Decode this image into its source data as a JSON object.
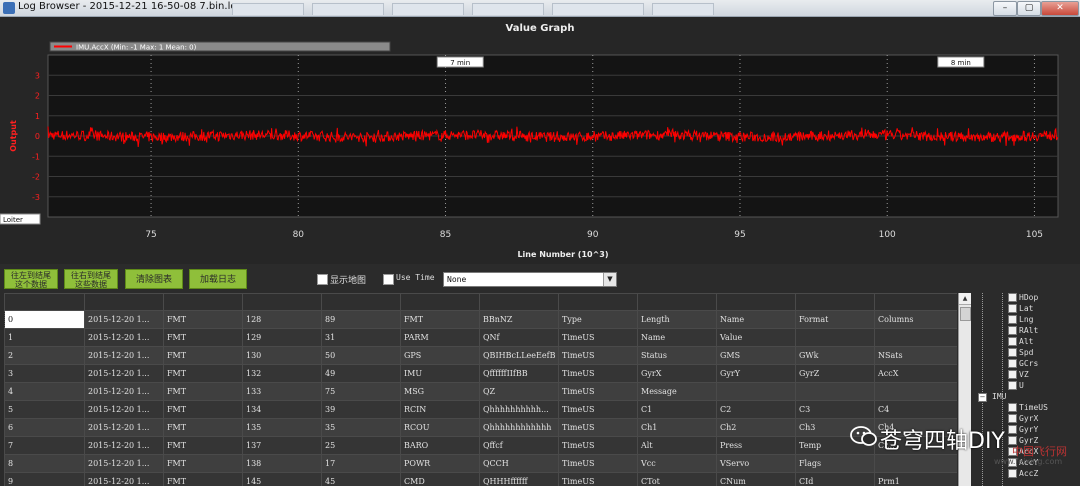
{
  "window": {
    "title": "Log Browser - 2015-12-21 16-50-08 7.bin.log",
    "buttons": [
      "–",
      "▢",
      "✕"
    ]
  },
  "graph": {
    "title": "Value Graph",
    "legend": "IMU.AccX (Min: -1 Max: 1 Mean: 0)",
    "mode_label": "Loiter",
    "time_markers": [
      {
        "label": "7 min",
        "x": 85.5
      },
      {
        "label": "8 min",
        "x": 102.5
      }
    ]
  },
  "chart_data": {
    "type": "line",
    "title": "Value Graph",
    "xlabel": "Line Number (10^3)",
    "ylabel": "Output",
    "xlim": [
      71.5,
      105.8
    ],
    "ylim": [
      -4,
      4
    ],
    "xticks": [
      75,
      80,
      85,
      90,
      95,
      100,
      105
    ],
    "yticks": [
      -4,
      -3,
      -2,
      -1,
      0,
      1,
      2,
      3
    ],
    "grid": true,
    "series": [
      {
        "name": "IMU.AccX",
        "color": "#ff0000",
        "min": -1,
        "max": 1,
        "mean": 0,
        "approx_band": [
          -0.35,
          0.45
        ]
      }
    ]
  },
  "toolbar": {
    "btn_left": [
      "往左到结尾",
      "这个数据"
    ],
    "btn_right": [
      "往右到结尾",
      "这些数据"
    ],
    "btn_clear": "清除图表",
    "btn_load": "加载日志",
    "show_map": "显示地图",
    "use_time": "Use Time",
    "select_value": "None"
  },
  "table": {
    "rows": [
      [
        "0",
        "2015-12-20 1...",
        "FMT",
        "128",
        "89",
        "FMT",
        "BBnNZ",
        "Type",
        "Length",
        "Name",
        "Format",
        "Columns"
      ],
      [
        "1",
        "2015-12-20 1...",
        "FMT",
        "129",
        "31",
        "PARM",
        "QNf",
        "TimeUS",
        "Name",
        "Value",
        "",
        ""
      ],
      [
        "2",
        "2015-12-20 1...",
        "FMT",
        "130",
        "50",
        "GPS",
        "QBIHBcLLeeEefB",
        "TimeUS",
        "Status",
        "GMS",
        "GWk",
        "NSats"
      ],
      [
        "3",
        "2015-12-20 1...",
        "FMT",
        "132",
        "49",
        "IMU",
        "QffffffIIfBB",
        "TimeUS",
        "GyrX",
        "GyrY",
        "GyrZ",
        "AccX"
      ],
      [
        "4",
        "2015-12-20 1...",
        "FMT",
        "133",
        "75",
        "MSG",
        "QZ",
        "TimeUS",
        "Message",
        "",
        "",
        ""
      ],
      [
        "5",
        "2015-12-20 1...",
        "FMT",
        "134",
        "39",
        "RCIN",
        "Qhhhhhhhhhh...",
        "TimeUS",
        "C1",
        "C2",
        "C3",
        "C4"
      ],
      [
        "6",
        "2015-12-20 1...",
        "FMT",
        "135",
        "35",
        "RCOU",
        "Qhhhhhhhhhhhh",
        "TimeUS",
        "Ch1",
        "Ch2",
        "Ch3",
        "Ch4"
      ],
      [
        "7",
        "2015-12-20 1...",
        "FMT",
        "137",
        "25",
        "BARO",
        "Qffcf",
        "TimeUS",
        "Alt",
        "Press",
        "Temp",
        "Cr..."
      ],
      [
        "8",
        "2015-12-20 1...",
        "FMT",
        "138",
        "17",
        "POWR",
        "QCCH",
        "TimeUS",
        "Vcc",
        "VServo",
        "Flags",
        ""
      ],
      [
        "9",
        "2015-12-20 1...",
        "FMT",
        "145",
        "45",
        "CMD",
        "QHHHffffff",
        "TimeUS",
        "CTot",
        "CNum",
        "CId",
        "Prm1"
      ]
    ]
  },
  "tree": {
    "items": [
      "HDop",
      "Lat",
      "Lng",
      "RAlt",
      "Alt",
      "Spd",
      "GCrs",
      "VZ",
      "U",
      "IMU",
      "TimeUS",
      "GyrX",
      "GyrY",
      "GyrZ",
      "AccX",
      "AccY",
      "AccZ"
    ]
  },
  "watermark": {
    "text": "苍穹四轴DIY",
    "site1": "中国飞行网",
    "site2": "www.feixing.com"
  }
}
